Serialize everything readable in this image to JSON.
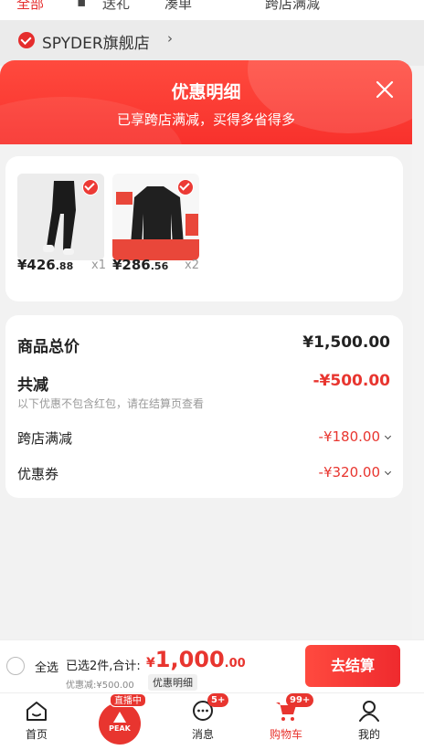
{
  "background": {
    "tabs": [
      "全部",
      "送礼",
      "凑单",
      "跨店满减"
    ],
    "store_name": "SPYDER旗舰店"
  },
  "sheet": {
    "title": "优惠明细",
    "subtitle": "已享跨店满减，买得多省得多"
  },
  "products": [
    {
      "price_int": "¥426",
      "price_dec": ".88",
      "qty": "x1"
    },
    {
      "price_int": "¥286",
      "price_dec": ".56",
      "qty": "x2"
    }
  ],
  "summary": {
    "goods_total_label": "商品总价",
    "goods_total_value": "¥1,500.00",
    "discount_label": "共减",
    "discount_value": "-¥500.00",
    "note": "以下优惠不包含红包，请在结算页查看",
    "cross_store_label": "跨店满减",
    "cross_store_value": "-¥180.00",
    "coupon_label": "优惠券",
    "coupon_value": "-¥320.00"
  },
  "settle": {
    "select_all": "全选",
    "selected_text": "已选2件,合计:",
    "currency": "¥",
    "total_int": "1,000",
    "total_dec": ".00",
    "discount_text": "优惠减:¥500.00",
    "detail_link": "优惠明细",
    "checkout": "去结算"
  },
  "tabbar": {
    "home": "首页",
    "live_badge": "直播中",
    "peak_label": "PEAK",
    "messages": "消息",
    "messages_badge": "5+",
    "cart": "购物车",
    "cart_badge": "99+",
    "mine": "我的"
  },
  "colors": {
    "accent": "#e8352f"
  }
}
